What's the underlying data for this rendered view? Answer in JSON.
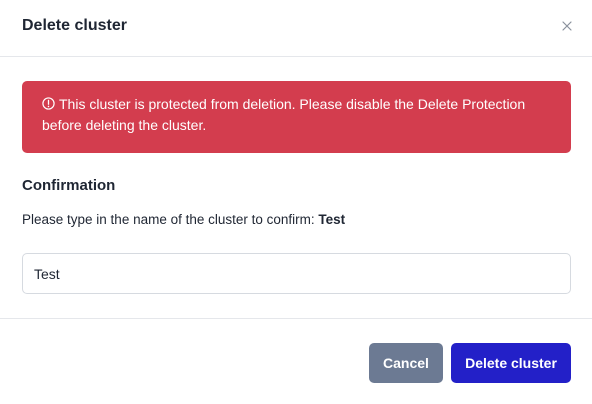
{
  "dialog": {
    "title": "Delete cluster",
    "close_icon": "close-icon"
  },
  "alert": {
    "icon": "info-circle-icon",
    "message": "This cluster is protected from deletion. Please disable the Delete Protection before deleting the cluster.",
    "color": "#d33d4e"
  },
  "confirmation": {
    "heading": "Confirmation",
    "instruction": "Please type in the name of the cluster to confirm:",
    "cluster_name": "Test",
    "input_value": "Test"
  },
  "footer": {
    "cancel_label": "Cancel",
    "delete_label": "Delete cluster",
    "cancel_color": "#6c7a93",
    "delete_color": "#2320c8"
  }
}
